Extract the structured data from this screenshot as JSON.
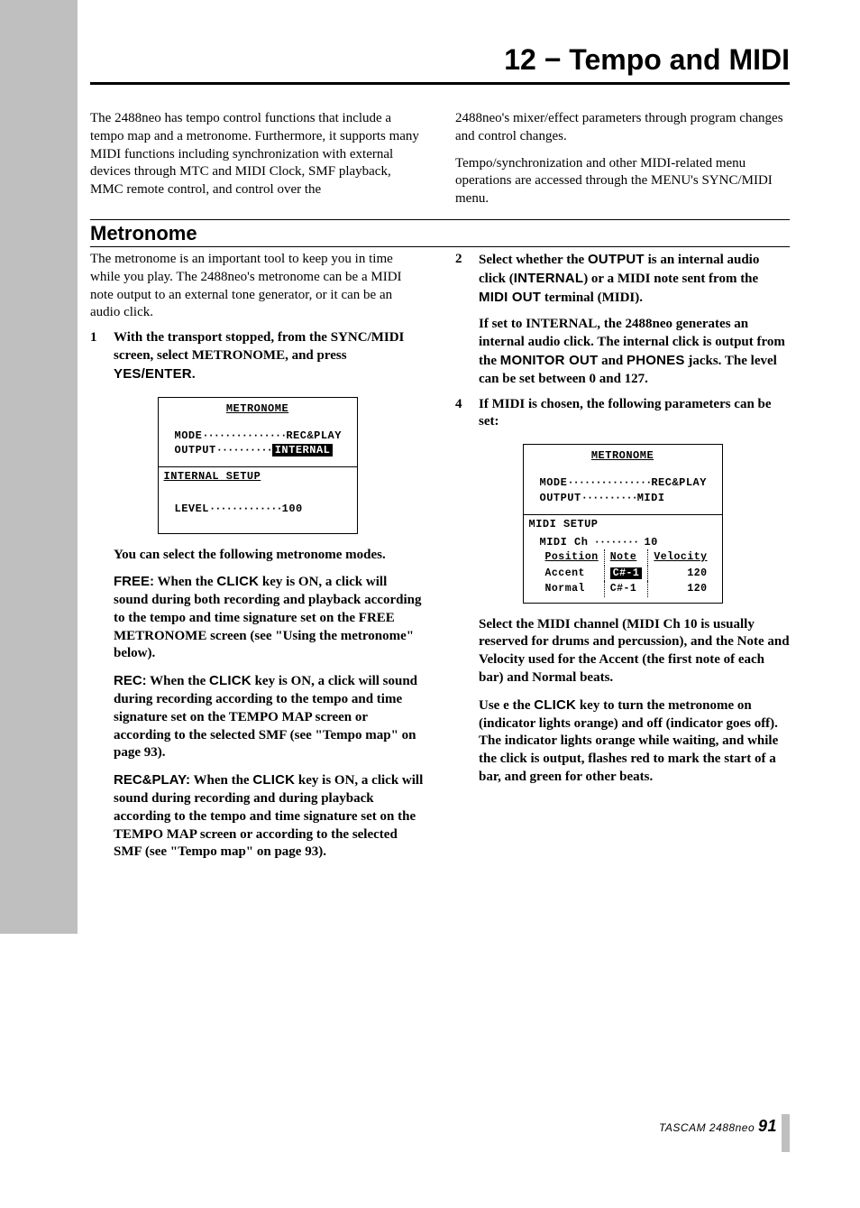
{
  "chapter_title": "12 − Tempo and MIDI",
  "intro": {
    "left": "The 2488neo has tempo control functions that include a tempo map and a metronome. Furthermore, it supports many MIDI functions including synchronization with external devices through MTC and MIDI Clock, SMF playback, MMC remote control, and control over the",
    "right_p1": "2488neo's mixer/effect parameters through program changes and control changes.",
    "right_p2": "Tempo/synchronization and other MIDI-related menu operations are accessed through the MENU's SYNC/MIDI menu."
  },
  "section_title": "Metronome",
  "left_col": {
    "intro": "The metronome is an important tool to keep you in time while you play. The 2488neo's metronome can be a MIDI note output to an external tone generator, or it can be an audio click.",
    "step1_num": "1",
    "step1_pre": "With the transport stopped, from the SYNC/MIDI screen, select METRONOME, and press ",
    "step1_key": "YES/ENTER",
    "step1_post": ".",
    "lcd1": {
      "title": "METRONOME",
      "mode_label": "MODE",
      "mode_value": "REC&PLAY",
      "output_label": "OUTPUT",
      "output_value": "INTERNAL",
      "sub": "INTERNAL SETUP",
      "level_label": "LEVEL",
      "level_value": "100"
    },
    "after_lcd": "You can select the following metronome modes.",
    "free_label": "FREE:",
    "free_text_a": " When the ",
    "free_key": "CLICK",
    "free_text_b": " key is ON, a click will sound during both recording and playback according to the tempo and time signature set on the FREE METRONOME screen (see \"Using the metronome\" below).",
    "rec_label": "REC:",
    "rec_text_a": " When the ",
    "rec_key": "CLICK",
    "rec_text_b": " key is ON, a click will sound during recording according to the tempo and time signature set on the TEMPO MAP screen or according to the selected SMF (see \"Tempo map\" on page 93).",
    "rp_label": "REC&PLAY:",
    "rp_text_a": " When the ",
    "rp_key": "CLICK",
    "rp_text_b": " key is ON, a click will sound during recording and during playback according to the tempo and time signature set on the TEMPO MAP screen or according to the selected SMF (see \"Tempo map\" on page 93)."
  },
  "right_col": {
    "step2_num": "2",
    "step2_a": "Select whether the ",
    "step2_key1": "OUTPUT",
    "step2_b": " is an internal audio click (",
    "step2_key2": "INTERNAL",
    "step2_c": ") or a MIDI note sent from the ",
    "step2_key3": "MIDI OUT",
    "step2_d": " terminal (MIDI).",
    "step2_p2a": "If set to INTERNAL, the 2488neo generates an internal audio click. The internal click is output from the ",
    "step2_p2key1": "MONITOR OUT",
    "step2_p2b": " and ",
    "step2_p2key2": "PHONES",
    "step2_p2c": " jacks. The level can be set between 0 and 127.",
    "step4_num": "4",
    "step4_text": "If MIDI is chosen, the following parameters can be set:",
    "lcd2": {
      "title": "METRONOME",
      "mode_label": "MODE",
      "mode_value": "REC&PLAY",
      "output_label": "OUTPUT",
      "output_value": "MIDI",
      "sub": "MIDI SETUP",
      "ch_label": "MIDI Ch",
      "ch_value": "10",
      "h1": "Position",
      "h2": "Note",
      "h3": "Velocity",
      "r1c1": "Accent",
      "r1c2": "C#-1",
      "r1c3": "120",
      "r2c1": "Normal",
      "r2c2": "C#-1",
      "r2c3": "120"
    },
    "p_after_lcd": "Select the MIDI channel (MIDI Ch 10 is usually reserved for drums and percussion), and the Note and Velocity used for the Accent (the first note of each bar) and Normal beats.",
    "p_last_a": "Use e the ",
    "p_last_key": "CLICK",
    "p_last_b": " key to turn the metronome on (indicator lights orange) and off (indicator goes off). The indicator lights orange while waiting, and while the click is output, flashes red to mark the start of a bar, and green for other beats."
  },
  "footer": {
    "product": "TASCAM  2488neo",
    "page": "91"
  }
}
